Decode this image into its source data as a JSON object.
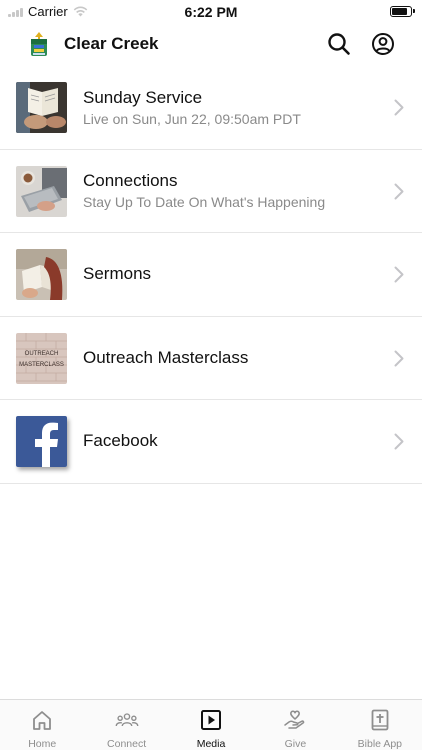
{
  "status_bar": {
    "carrier": "Carrier",
    "time": "6:22 PM",
    "battery_level": 0.9
  },
  "header": {
    "title": "Clear Creek",
    "logo_icon": "church-logo-icon",
    "search_icon": "search-icon",
    "account_icon": "account-icon"
  },
  "media_items": [
    {
      "title": "Sunday Service",
      "subtitle": "Live on Sun, Jun 22, 09:50am PDT",
      "thumbnail": "photo of open bible"
    },
    {
      "title": "Connections",
      "subtitle": "Stay Up To Date On What's Happening",
      "thumbnail": "photo of laptop and coffee"
    },
    {
      "title": "Sermons",
      "subtitle": "",
      "thumbnail": "photo of person reading"
    },
    {
      "title": "Outreach Masterclass",
      "subtitle": "",
      "thumbnail_text": [
        "OUTREACH",
        "MASTERCLASS"
      ]
    },
    {
      "title": "Facebook",
      "subtitle": "",
      "thumbnail": "facebook-logo"
    }
  ],
  "tabs": [
    {
      "label": "Home",
      "icon": "home-icon",
      "active": false
    },
    {
      "label": "Connect",
      "icon": "people-icon",
      "active": false
    },
    {
      "label": "Media",
      "icon": "play-icon",
      "active": true
    },
    {
      "label": "Give",
      "icon": "give-hand-icon",
      "active": false
    },
    {
      "label": "Bible App",
      "icon": "bible-icon",
      "active": false
    }
  ],
  "colors": {
    "accent": "#111111",
    "inactive": "#8e8e8e",
    "subtitle": "#8a8a8a",
    "facebook": "#3b5998"
  }
}
